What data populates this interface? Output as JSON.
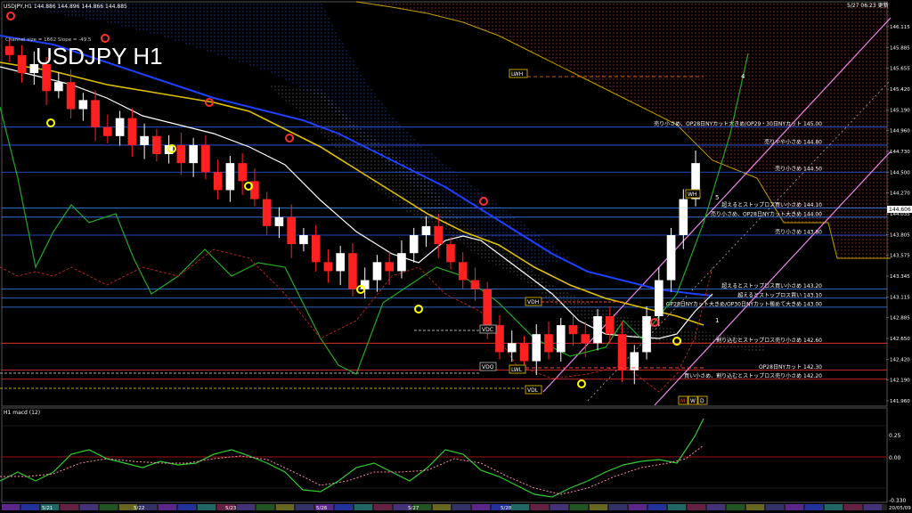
{
  "header": {
    "symbol_line": "USDJPY,H1  144.886  144.896  144.866  144.885",
    "datetime": "5/27  06:23  更新",
    "indicator_note": "Channel size = 1662  Slope = -49.5"
  },
  "title": "USDJPY H1",
  "price_axis": {
    "labels": [
      "146.115",
      "145.885",
      "145.655",
      "145.420",
      "145.190",
      "144.960",
      "144.730",
      "144.500",
      "144.270",
      "144.035",
      "143.805",
      "143.575",
      "143.345",
      "143.115",
      "142.885",
      "142.650",
      "142.420",
      "142.190",
      "141.960"
    ],
    "current_price": "144.606",
    "current_price_color": "#ffffff"
  },
  "levels": [
    {
      "label": "売り小さめ、OP28日NYカット大きめ/OP29・30日NYカット 145.00",
      "price": 145.0,
      "color": "#3060ff"
    },
    {
      "label": "売りやや小さめ 144.80",
      "price": 144.8,
      "color": "#3060ff"
    },
    {
      "label": "売り小さめ 144.50",
      "price": 144.5,
      "color": "#3060ff"
    },
    {
      "label": "超えるとストップロス買い小さめ 144.10",
      "price": 144.1,
      "color": "#4080ff"
    },
    {
      "label": "売り小さめ、OP28日NYカット大きめ 144.00",
      "price": 144.0,
      "color": "#4080ff"
    },
    {
      "label": "売り小さめ 143.80",
      "price": 143.8,
      "color": "#3060ff"
    },
    {
      "label": "超えるとストップロス買い小さめ 143.20",
      "price": 143.2,
      "color": "#4080ff"
    },
    {
      "label": "超えるとストップロス買い 143.10",
      "price": 143.1,
      "color": "#4080ff"
    },
    {
      "label": "OP28日NYカット大きめ/OP30日NYカット極めて大きめ 143.00",
      "price": 143.0,
      "color": "#4080ff"
    },
    {
      "label": "割り込むとストップロス売り小さめ 142.60",
      "price": 142.6,
      "color": "#ff3030"
    },
    {
      "label": "OP28日NYカット 142.30",
      "price": 142.3,
      "color": "#ff3030"
    },
    {
      "label": "買い小さめ、割り込むとストップロス売り小さめ 142.20",
      "price": 142.2,
      "color": "#ff3030"
    }
  ],
  "box_labels": {
    "lwh": "LWH",
    "vdh": "VDH",
    "vdc": "VDC",
    "vdo": "VDO",
    "lwl": "LWL",
    "vdl": "VDL",
    "wh": "WH",
    "m": "M",
    "w": "W",
    "d": "D"
  },
  "wave_labels": [
    "4",
    "5",
    "1"
  ],
  "macd": {
    "label": "H1  macd (12)",
    "axis_labels": [
      "0.25",
      "0.00",
      "-0.330"
    ],
    "macd_color": "#33cc33",
    "signal_color": "#ff88aa"
  },
  "time_axis": {
    "labels": [
      "5/21",
      "5/22",
      "5/23",
      "5/26",
      "5/27",
      "5/28"
    ],
    "right_label": "20/05/09"
  },
  "colors": {
    "candle_up": "#ffffff",
    "candle_down": "#ff2020",
    "ma_fast": "#ffffff",
    "ma_mid": "#e0c000",
    "ma_slow": "#2040ff",
    "cloud": "#a03030",
    "channel": "#ee88ee"
  },
  "chart_data": {
    "type": "line",
    "title": "USDJPY H1",
    "ylim": [
      141.96,
      146.23
    ],
    "close_series": [
      145.8,
      145.6,
      145.7,
      145.4,
      145.5,
      145.2,
      145.3,
      145.0,
      144.9,
      145.1,
      144.8,
      144.9,
      144.7,
      144.8,
      144.6,
      144.8,
      144.5,
      144.3,
      144.6,
      144.4,
      144.2,
      143.9,
      144.0,
      143.7,
      143.8,
      143.5,
      143.4,
      143.6,
      143.2,
      143.3,
      143.5,
      143.4,
      143.6,
      143.8,
      143.9,
      143.7,
      143.5,
      143.3,
      143.2,
      142.8,
      142.5,
      142.6,
      142.4,
      142.7,
      142.5,
      142.8,
      142.7,
      142.6,
      142.9,
      142.7,
      142.3,
      142.5,
      142.9,
      143.3,
      143.8,
      144.2,
      144.6
    ]
  }
}
